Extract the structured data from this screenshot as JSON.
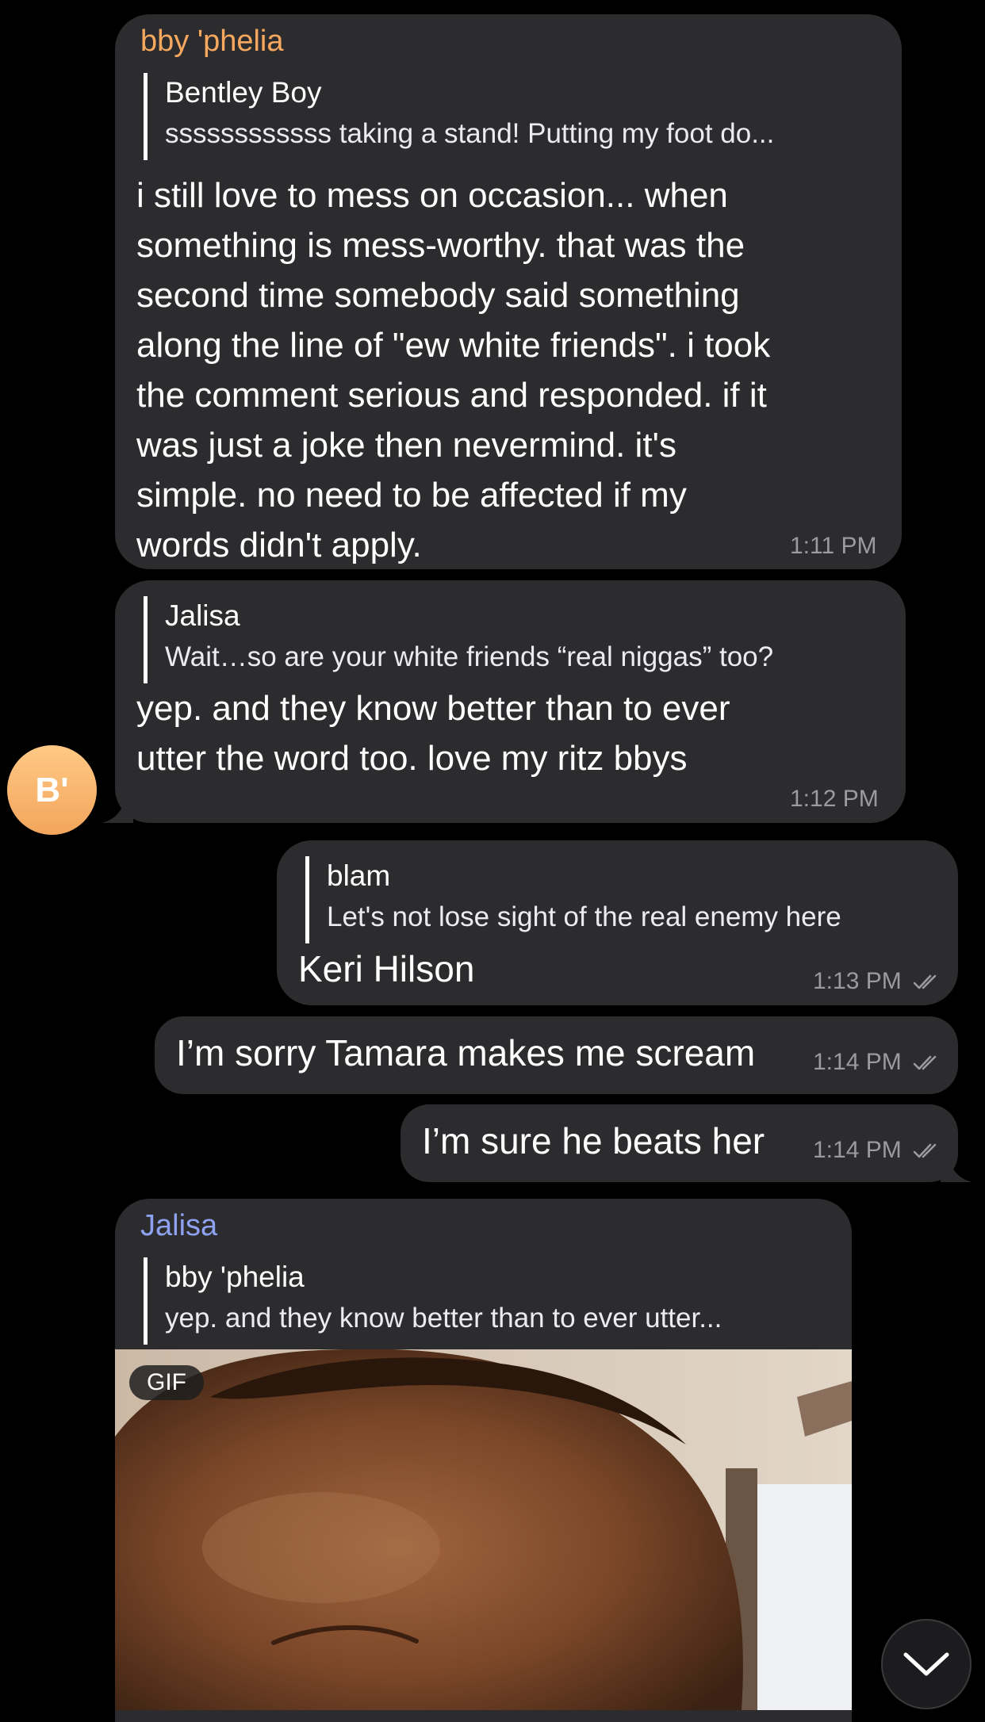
{
  "colors": {
    "background": "#000000",
    "bubble": "#2c2c2e",
    "sender_ophelia": "#f6a85f",
    "sender_jalisa": "#8fa2f2",
    "timestamp": "#9a9aa0",
    "avatar": "#f3a55c"
  },
  "messages": [
    {
      "sender": "bby 'phelia",
      "reply_name": "Bentley Boy",
      "reply_text": "ssssssssssss taking a stand! Putting my foot do...",
      "text": "i still love to mess on occasion... when\nsomething is mess-worthy. that was the\nsecond time somebody said something\nalong the line of \"ew white friends\". i took\nthe comment serious and responded. if it\nwas just a joke then nevermind. it's\nsimple. no need to be affected if my\nwords didn't apply.",
      "time": "1:11 PM"
    },
    {
      "reply_name": "Jalisa",
      "reply_text": "Wait…so are your white friends “real niggas” too?",
      "text": "yep. and they know better than to ever\nutter the word too. love my ritz bbys",
      "time": "1:12 PM"
    },
    {
      "reply_name": "blam",
      "reply_text": "Let's not lose sight of the real enemy here",
      "text": "Keri Hilson",
      "time": "1:13 PM"
    },
    {
      "text": "I’m sorry Tamara makes me scream",
      "time": "1:14 PM"
    },
    {
      "text": "I’m sure he beats her",
      "time": "1:14 PM"
    },
    {
      "sender": "Jalisa",
      "reply_name": "bby 'phelia",
      "reply_text": "yep. and they know better than to ever utter...",
      "media_badge": "GIF"
    }
  ],
  "avatar": {
    "initials": "B'"
  },
  "icons": {
    "read_receipt": "double-check-icon",
    "scroll_down": "chevron-down-icon"
  }
}
